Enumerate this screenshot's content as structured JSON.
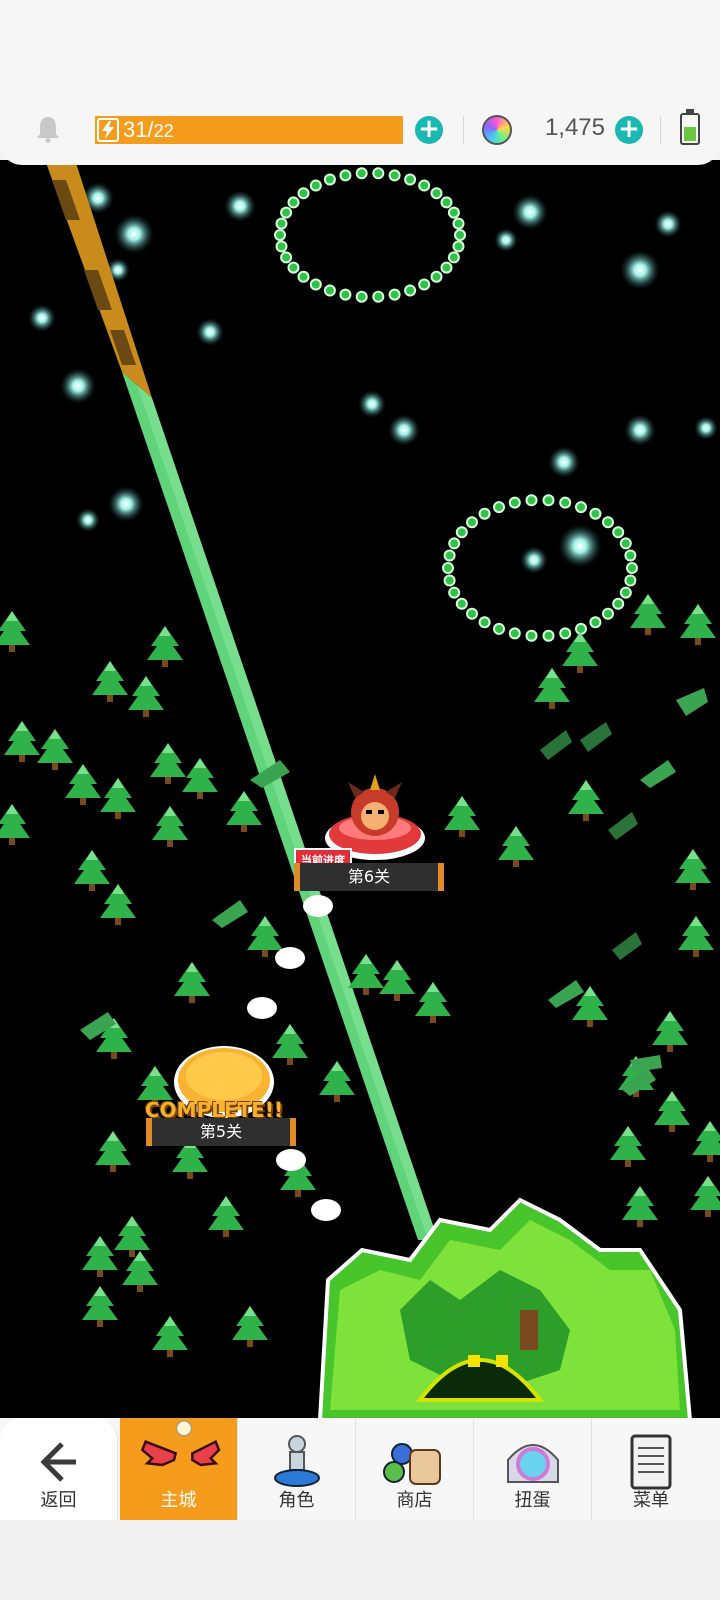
{
  "resources": {
    "energy_current": "31",
    "energy_max": "22",
    "energy_fill": 1.0,
    "gem_count": "1,475",
    "plus_label": "+"
  },
  "map": {
    "current_level": {
      "label": "第6关",
      "badge": "当前进度"
    },
    "completed_level": {
      "label": "第5关",
      "status": "COMPLETE!!"
    }
  },
  "nav": {
    "back": "返回",
    "main_city": "主城",
    "character": "角色",
    "shop": "商店",
    "gacha": "扭蛋",
    "menu": "菜单"
  },
  "colors": {
    "accent": "#f59c1d",
    "teal": "#19b8b3",
    "path_green": "#5fd47a",
    "tree_green": "#2fb24a"
  }
}
